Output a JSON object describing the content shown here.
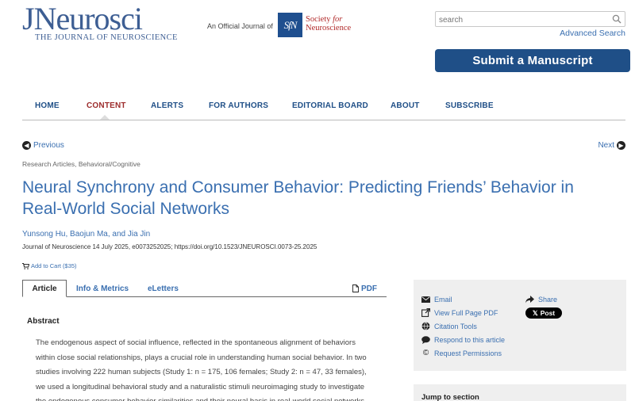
{
  "header": {
    "logo_main": "JNeurosci",
    "logo_sub": "THE JOURNAL OF NEUROSCIENCE",
    "official_label": "An Official Journal of",
    "society_mark": "SfN",
    "society_line1": "Society",
    "society_for": "for",
    "society_line2": "Neuroscience",
    "search_placeholder": "search",
    "advanced_search": "Advanced Search",
    "submit_button": "Submit a Manuscript"
  },
  "nav": {
    "items": [
      "HOME",
      "CONTENT",
      "ALERTS",
      "FOR AUTHORS",
      "EDITORIAL BOARD",
      "ABOUT",
      "SUBSCRIBE"
    ],
    "active": "CONTENT"
  },
  "pager": {
    "previous": "Previous",
    "next": "Next"
  },
  "article": {
    "breadcrumb": "Research Articles, Behavioral/Cognitive",
    "title": "Neural Synchrony and Consumer Behavior: Predicting Friends’ Behavior in Real-World Social Networks",
    "authors": "Yunsong Hu, Baojun Ma, and Jia Jin",
    "citation": "Journal of Neuroscience 14 July 2025, e0073252025; https://doi.org/10.1523/JNEUROSCI.0073-25.2025",
    "cart": "Add to Cart ($35)"
  },
  "tabs": {
    "article": "Article",
    "info": "Info & Metrics",
    "eletters": "eLetters",
    "pdf": "PDF"
  },
  "abstract": {
    "heading": "Abstract",
    "lines": [
      "The endogenous aspect of social influence, reflected in the spontaneous alignment of behaviors",
      "within close social relationships, plays a crucial role in understanding human social behavior. In two",
      "studies involving 222 human subjects (Study 1: n = 175, 106 females; Study 2: n = 47, 33 females),",
      "we used a longitudinal behavioral study and a naturalistic stimuli neuroimaging study to investigate",
      "the endogenous consumer behavior similarities and their neural basis in real-world social networks."
    ]
  },
  "sidebar": {
    "email": "Email",
    "share": "Share",
    "view_pdf": "View Full Page PDF",
    "x_post": "Post",
    "citation_tools": "Citation Tools",
    "respond": "Respond to this article",
    "permissions": "Request Permissions",
    "jump_title": "Jump to section"
  },
  "colors": {
    "link": "#3a6fb0",
    "brand_navy": "#1f4f87",
    "active_nav": "#9c2b2b",
    "sidebar_bg": "#efefef"
  }
}
